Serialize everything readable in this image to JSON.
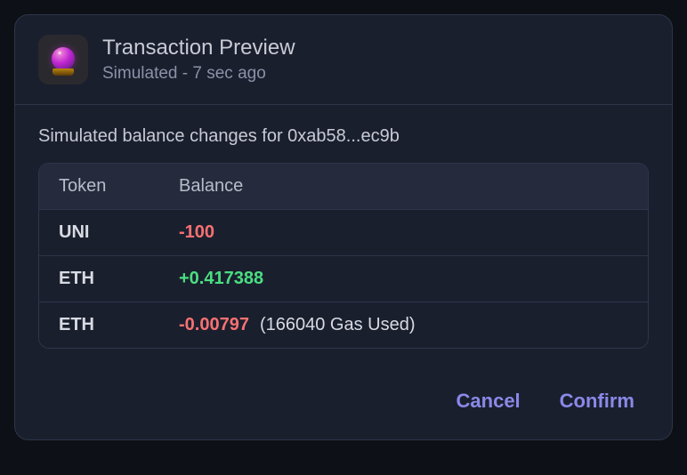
{
  "header": {
    "title": "Transaction Preview",
    "subtitle": "Simulated - 7 sec ago"
  },
  "description": "Simulated balance changes for 0xab58...ec9b",
  "table": {
    "headers": {
      "token": "Token",
      "balance": "Balance"
    },
    "rows": [
      {
        "token": "UNI",
        "balance": "-100",
        "direction": "negative",
        "extra": ""
      },
      {
        "token": "ETH",
        "balance": "+0.417388",
        "direction": "positive",
        "extra": ""
      },
      {
        "token": "ETH",
        "balance": "-0.00797",
        "direction": "negative",
        "extra": "(166040 Gas Used)"
      }
    ]
  },
  "footer": {
    "cancel": "Cancel",
    "confirm": "Confirm"
  }
}
